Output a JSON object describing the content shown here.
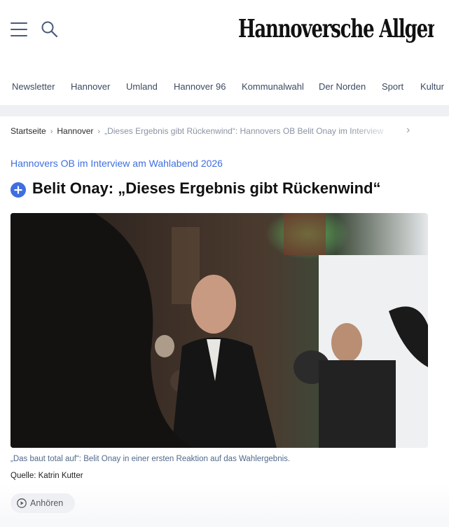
{
  "header": {
    "logo_text": "Hannoversche Allgemeine",
    "menu_icon": "hamburger-icon",
    "search_icon": "search-icon"
  },
  "nav": {
    "items": [
      "Newsletter",
      "Hannover",
      "Umland",
      "Hannover 96",
      "Kommunalwahl",
      "Der Norden",
      "Sport",
      "Kultur"
    ]
  },
  "breadcrumb": {
    "items": [
      "Startseite",
      "Hannover",
      "„Dieses Ergebnis gibt Rückenwind“: Hannovers OB Belit Onay im Interview"
    ],
    "next_icon": "chevron-right-icon"
  },
  "article": {
    "kicker": "Hannovers OB im Interview am Wahlabend 2026",
    "plus_icon": "plus-circle-icon",
    "headline": "Belit Onay: „Dieses Ergebnis gibt Rückenwind“",
    "image_caption": "„Das baut total auf“: Belit Onay in einer ersten Reaktion auf das Wahlergebnis.",
    "image_source": "Quelle: Katrin Kutter",
    "listen_label": "Anhören",
    "listen_icon": "play-circle-icon"
  },
  "colors": {
    "accent_blue": "#3e6ee0",
    "nav_text": "#3c4a62",
    "caption_text": "#4f6a8a"
  }
}
